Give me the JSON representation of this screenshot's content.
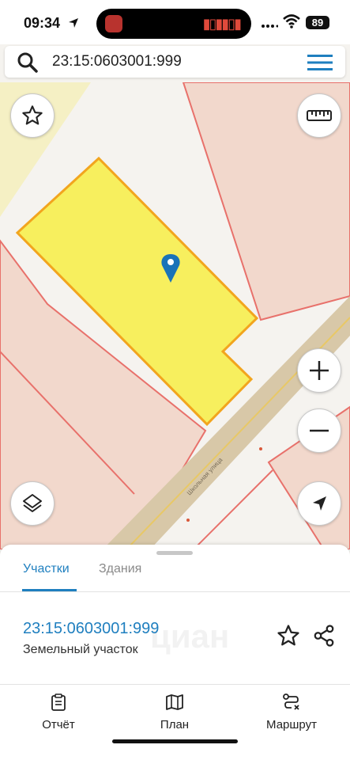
{
  "status_bar": {
    "time": "09:34",
    "battery": "89"
  },
  "search": {
    "query": "23:15:0603001:999"
  },
  "map": {
    "street_label": "Школьная улица",
    "colors": {
      "parcel_selected": "#f7ef5e",
      "parcel": "#f2d8cc",
      "parcel_border": "#e8716b",
      "road": "#d8c8a8",
      "background": "#f5f3ef"
    }
  },
  "tabs": [
    {
      "label": "Участки",
      "active": true
    },
    {
      "label": "Здания",
      "active": false
    }
  ],
  "result": {
    "cadastral_number": "23:15:0603001:999",
    "type": "Земельный участок"
  },
  "watermark": "циан",
  "bottom_nav": [
    {
      "label": "Отчёт",
      "icon": "report-icon"
    },
    {
      "label": "План",
      "icon": "map-plan-icon"
    },
    {
      "label": "Маршрут",
      "icon": "route-icon"
    }
  ],
  "accent_color": "#1f7fbf"
}
